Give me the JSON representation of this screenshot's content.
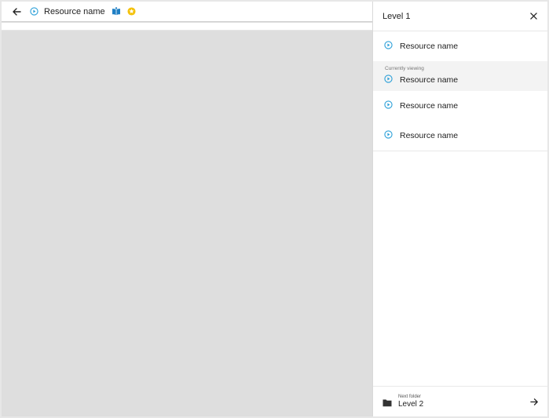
{
  "header": {
    "title": "Resource name"
  },
  "panel": {
    "title": "Level 1",
    "current_caption": "Currently viewing",
    "items": [
      {
        "label": "Resource name"
      },
      {
        "label": "Resource name"
      },
      {
        "label": "Resource name"
      },
      {
        "label": "Resource name"
      }
    ],
    "footer": {
      "caption": "Next folder",
      "label": "Level 2"
    }
  },
  "icons": {
    "back": "arrow-left-icon",
    "play": "play-circle-icon",
    "book": "book-icon",
    "star": "star-badge-icon",
    "close": "close-icon",
    "folder": "folder-icon",
    "next": "arrow-right-icon"
  },
  "colors": {
    "accent": "#2a9fd8",
    "book": "#1f7fc4",
    "star": "#f4c20d",
    "content_bg": "#dedede",
    "current_row": "#f3f3f3"
  }
}
